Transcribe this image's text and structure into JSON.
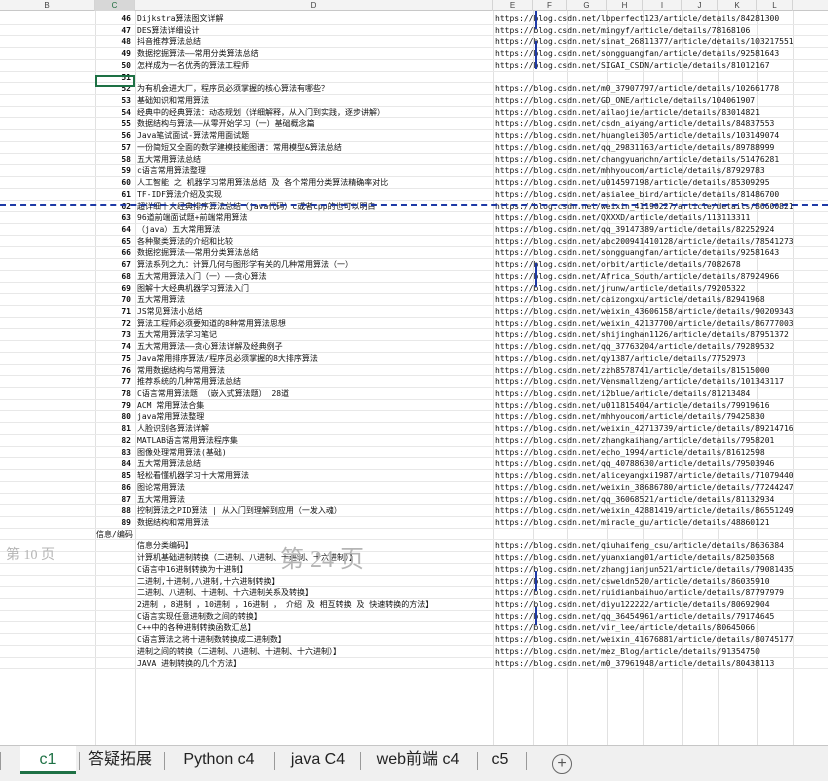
{
  "columns": [
    "B",
    "C",
    "D",
    "E",
    "F",
    "G",
    "H",
    "I",
    "J",
    "K",
    "L"
  ],
  "watermarks": {
    "left": "第 10 页",
    "center": "第 24 页"
  },
  "sheet_tabs": [
    "c1",
    "答疑拓展",
    "Python c4",
    "java C4",
    "web前端 c4",
    "c5"
  ],
  "add_sheet": "+",
  "section_label": "信息/编码",
  "rows": [
    {
      "num": "46",
      "title": "Dijkstra算法图文详解",
      "url": "https://blog.csdn.net/lbperfect123/article/details/84281300"
    },
    {
      "num": "47",
      "title": "DES算法详细设计",
      "url": "https://blog.csdn.net/mingyf/article/details/78168106"
    },
    {
      "num": "48",
      "title": "抖音推荐算法总结",
      "url": "https://blog.csdn.net/sinat_26811377/article/details/103217551"
    },
    {
      "num": "49",
      "title": "数据挖掘算法——常用分类算法总结",
      "url": "https://blog.csdn.net/songguangfan/article/details/92581643"
    },
    {
      "num": "50",
      "title": "怎样成为一名优秀的算法工程师",
      "url": "https://blog.csdn.net/SIGAI_CSDN/article/details/81012167"
    },
    {
      "num": "51",
      "title": "",
      "url": ""
    },
    {
      "num": "52",
      "title": "为有机会进大厂，程序员必须掌握的核心算法有哪些？",
      "url": "https://blog.csdn.net/m0_37907797/article/details/102661778"
    },
    {
      "num": "53",
      "title": "基础知识和常用算法",
      "url": "https://blog.csdn.net/GD_ONE/article/details/104061907"
    },
    {
      "num": "54",
      "title": "经典中的经典算法：动态规划（详细解释，从入门到实践，逐步讲解）",
      "url": "https://blog.csdn.net/ailaojie/article/details/83014821"
    },
    {
      "num": "55",
      "title": "数据结构与算法——从零开始学习（一）基础概念篇",
      "url": "https://blog.csdn.net/csdn_aiyang/article/details/84837553"
    },
    {
      "num": "56",
      "title": "Java笔试面试-算法常用面试题",
      "url": "https://blog.csdn.net/huanglei305/article/details/103149074"
    },
    {
      "num": "57",
      "title": "一份简短又全面的数学建模技能图谱：常用模型&算法总结",
      "url": "https://blog.csdn.net/qq_29831163/article/details/89788999"
    },
    {
      "num": "58",
      "title": "五大常用算法总结",
      "url": "https://blog.csdn.net/changyuanchn/article/details/51476281"
    },
    {
      "num": "59",
      "title": "c语言常用算法整理",
      "url": "https://blog.csdn.net/mhhyoucom/article/details/87929783"
    },
    {
      "num": "60",
      "title": "人工智能 之 机器学习常用算法总结 及 各个常用分类算法精确率对比",
      "url": "https://blog.csdn.net/u014597198/article/details/85309295"
    },
    {
      "num": "61",
      "title": "TF-IDF算法介绍及实现",
      "url": "https://blog.csdn.net/asialee_bird/article/details/81486700"
    },
    {
      "num": "62",
      "title": "超详细十大经典排序算法总结（java代码）c或者cpp的也可以明白",
      "url": "https://blog.csdn.net/weixin_41190227/article/details/86600821"
    },
    {
      "num": "63",
      "title": "96道前端面试题+前端常用算法",
      "url": "https://blog.csdn.net/QXXXD/article/details/113113311"
    },
    {
      "num": "64",
      "title": "（java）五大常用算法",
      "url": "https://blog.csdn.net/qq_39147389/article/details/82252924"
    },
    {
      "num": "65",
      "title": "各种聚类算法的介绍和比较",
      "url": "https://blog.csdn.net/abc200941410128/article/details/78541273"
    },
    {
      "num": "66",
      "title": "数据挖掘算法——常用分类算法总结",
      "url": "https://blog.csdn.net/songguangfan/article/details/92581643"
    },
    {
      "num": "67",
      "title": "算法系列之九：计算几何与图形学有关的几种常用算法（一）",
      "url": "https://blog.csdn.net/orbit/article/details/7082678"
    },
    {
      "num": "68",
      "title": "五大常用算法入门（一）——贪心算法",
      "url": "https://blog.csdn.net/Africa_South/article/details/87924966"
    },
    {
      "num": "69",
      "title": "图解十大经典机器学习算法入门",
      "url": "https://blog.csdn.net/jrunw/article/details/79205322"
    },
    {
      "num": "70",
      "title": "五大常用算法",
      "url": "https://blog.csdn.net/caizongxu/article/details/82941968"
    },
    {
      "num": "71",
      "title": "JS常见算法小总结",
      "url": "https://blog.csdn.net/weixin_43606158/article/details/90209343"
    },
    {
      "num": "72",
      "title": "算法工程师必须要知道的8种常用算法思想",
      "url": "https://blog.csdn.net/weixin_42137700/article/details/86777003"
    },
    {
      "num": "73",
      "title": "五大常用算法学习笔记",
      "url": "https://blog.csdn.net/shijinghan1126/article/details/87951372"
    },
    {
      "num": "74",
      "title": "五大常用算法——贪心算法详解及经典例子",
      "url": "https://blog.csdn.net/qq_37763204/article/details/79289532"
    },
    {
      "num": "75",
      "title": "Java常用排序算法/程序员必须掌握的8大排序算法",
      "url": "https://blog.csdn.net/qy1387/article/details/7752973"
    },
    {
      "num": "76",
      "title": "常用数据结构与常用算法",
      "url": "https://blog.csdn.net/zzh8578741/article/details/81515000"
    },
    {
      "num": "77",
      "title": "推荐系统的几种常用算法总结",
      "url": "https://blog.csdn.net/Vensmallzeng/article/details/101343117"
    },
    {
      "num": "78",
      "title": "C语言常用算法题 （嵌入式算法题） 28道",
      "url": "https://blog.csdn.net/i2blue/article/details/81213484"
    },
    {
      "num": "79",
      "title": "ACM 常用算法合集",
      "url": "https://blog.csdn.net/u011815404/article/details/79919616"
    },
    {
      "num": "80",
      "title": "java常用算法整理",
      "url": "https://blog.csdn.net/mhhyoucom/article/details/79425830"
    },
    {
      "num": "81",
      "title": "人脸识别各算法详解",
      "url": "https://blog.csdn.net/weixin_42713739/article/details/89214716"
    },
    {
      "num": "82",
      "title": "MATLAB语言常用算法程序集",
      "url": "https://blog.csdn.net/zhangkaihang/article/details/7958201"
    },
    {
      "num": "83",
      "title": "图像处理常用算法(基础)",
      "url": "https://blog.csdn.net/echo_1994/article/details/81612598"
    },
    {
      "num": "84",
      "title": "五大常用算法总结",
      "url": "https://blog.csdn.net/qq_40788630/article/details/79503946"
    },
    {
      "num": "85",
      "title": "轻松看懂机器学习十大常用算法",
      "url": "https://blog.csdn.net/aliceyangxi1987/article/details/71079440"
    },
    {
      "num": "86",
      "title": "图论常用算法",
      "url": "https://blog.csdn.net/weixin_38686780/article/details/77244247"
    },
    {
      "num": "87",
      "title": "五大常用算法",
      "url": "https://blog.csdn.net/qq_36068521/article/details/81132934"
    },
    {
      "num": "88",
      "title": "控制算法之PID算法 | 从入门到理解到应用（一发入魂）",
      "url": "https://blog.csdn.net/weixin_42881419/article/details/86551249"
    },
    {
      "num": "89",
      "title": "数据结构和常用算法",
      "url": "https://blog.csdn.net/miracle_gu/article/details/48860121"
    },
    {
      "num": "",
      "title": "",
      "url": ""
    },
    {
      "num": "",
      "title": "信息分类编码】",
      "url": "https://blog.csdn.net/qiuhaifeng_csu/article/details/8636384"
    },
    {
      "num": "",
      "title": "计算机基础进制转换（二进制、八进制、十进制、十六进制）】",
      "url": "https://blog.csdn.net/yuanxiang01/article/details/82503568"
    },
    {
      "num": "",
      "title": "C语言中16进制转换为十进制】",
      "url": "https://blog.csdn.net/zhangjianjun521/article/details/79081435"
    },
    {
      "num": "",
      "title": "二进制,十进制,八进制,十六进制转换】",
      "url": "https://blog.csdn.net/csweldn520/article/details/86035910"
    },
    {
      "num": "",
      "title": "二进制、八进制、十进制、十六进制关系及转换】",
      "url": "https://blog.csdn.net/ruidianbaihuo/article/details/87797979"
    },
    {
      "num": "",
      "title": "2进制 ，8进制 ，10进制 ，16进制 ， 介绍 及 相互转换 及 快速转换的方法】",
      "url": "https://blog.csdn.net/diyu122222/article/details/80692904"
    },
    {
      "num": "",
      "title": "C语言实现任意进制数之间的转换】",
      "url": "https://blog.csdn.net/qq_36454961/article/details/79174645"
    },
    {
      "num": "",
      "title": "C++中的各种进制转换函数汇总】",
      "url": "https://blog.csdn.net/vir_lee/article/details/80645066"
    },
    {
      "num": "",
      "title": "C语言算法之将十进制数转换成二进制数】",
      "url": "https://blog.csdn.net/weixin_41676881/article/details/80745177"
    },
    {
      "num": "",
      "title": "进制之间的转换（二进制、八进制、十进制、十六进制）】",
      "url": "https://blog.csdn.net/mez_Blog/article/details/91354750"
    },
    {
      "num": "",
      "title": "JAVA 进制转换的几个方法】",
      "url": "https://blog.csdn.net/m0_37961948/article/details/80438113"
    }
  ]
}
